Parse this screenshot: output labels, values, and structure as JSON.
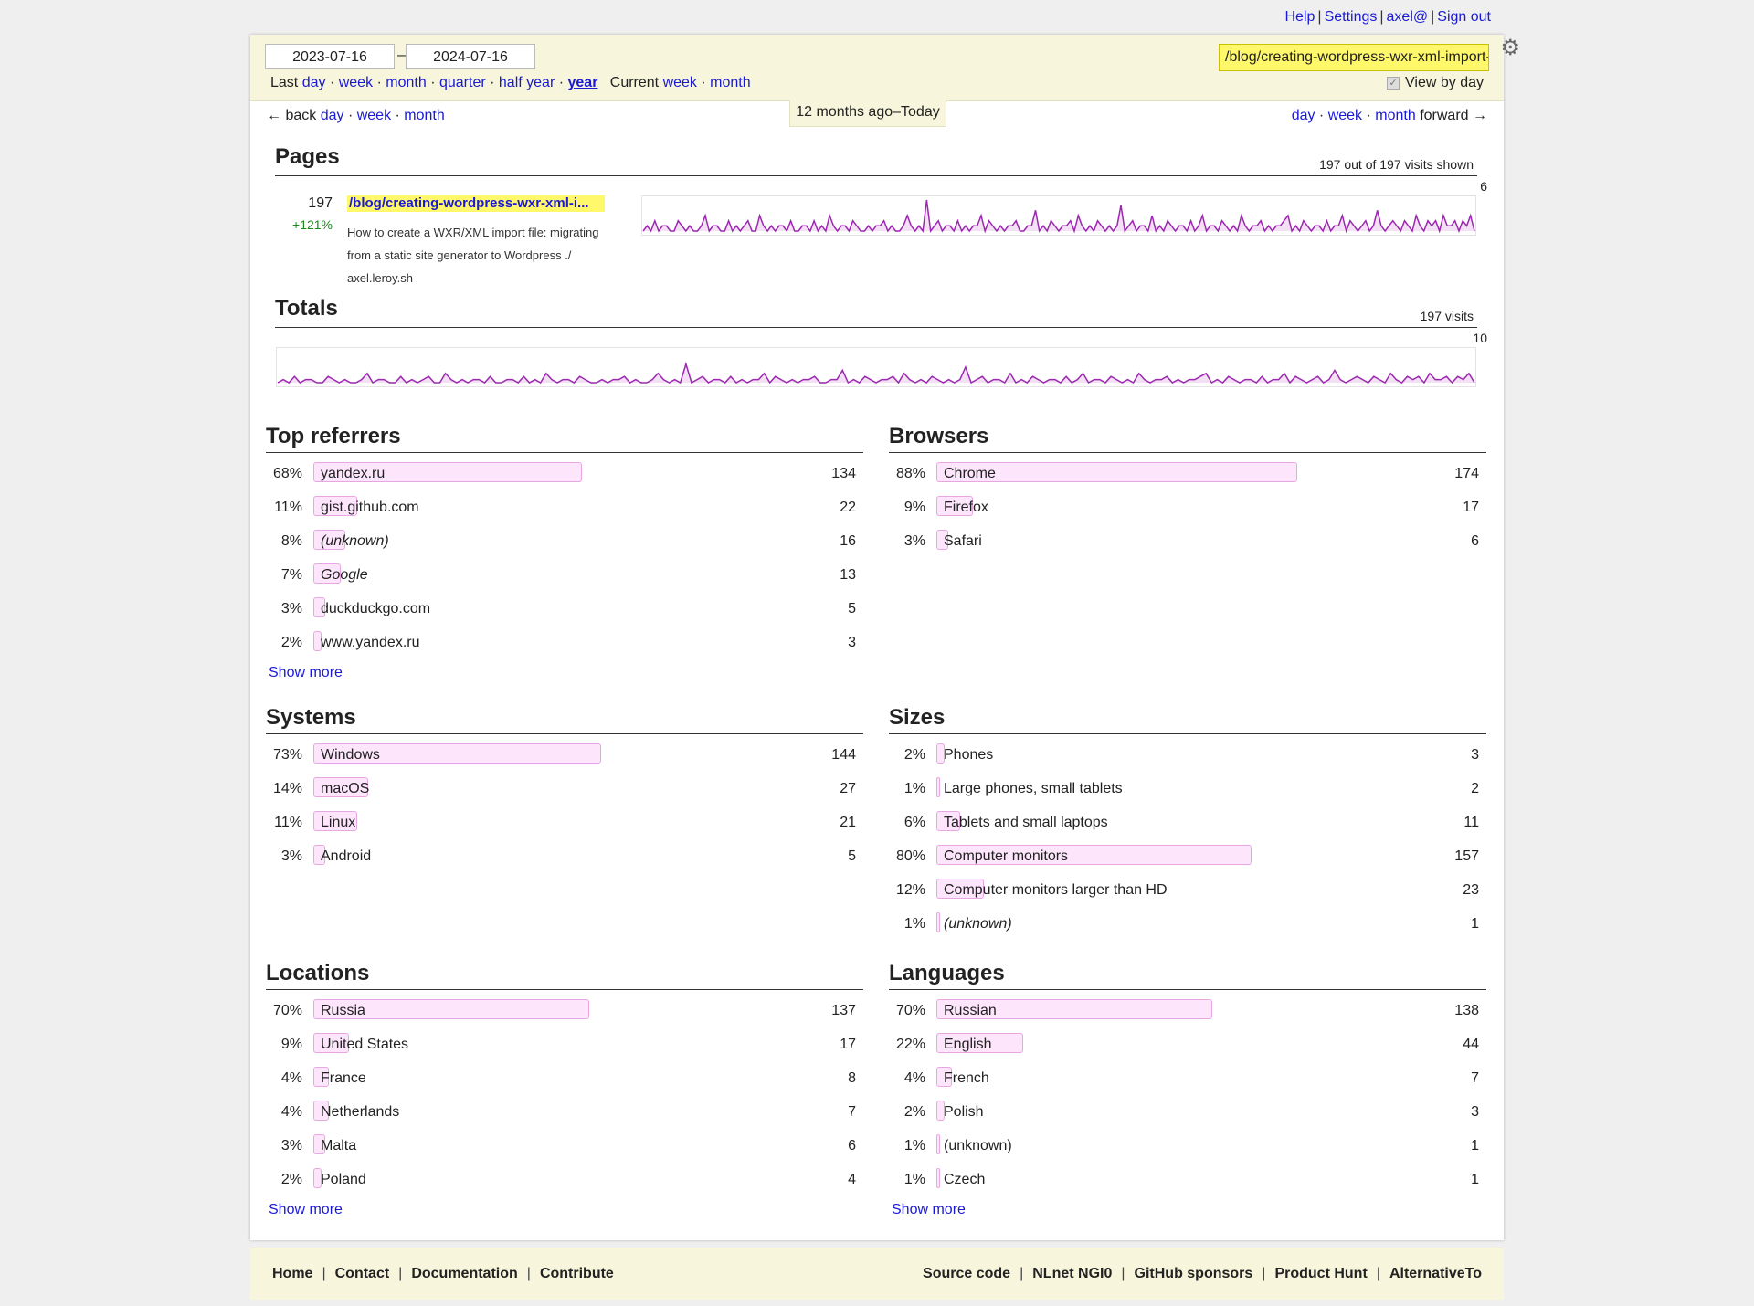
{
  "top_nav": {
    "help": "Help",
    "settings": "Settings",
    "user": "axel@",
    "signout": "Sign out",
    "sep": "|"
  },
  "filter": {
    "start_date": "2023-07-16",
    "end_date": "2024-07-16",
    "dash": "–",
    "last_label": "Last",
    "last_options": [
      "day",
      "week",
      "month",
      "quarter",
      "half year",
      "year"
    ],
    "selected": "year",
    "current_label": "Current",
    "current_options": [
      "week",
      "month"
    ],
    "path_filter": "/blog/creating-wordpress-wxr-xml-import-file",
    "view_by_day": "View by day"
  },
  "period_nav": {
    "back": "← back",
    "forward": "forward →",
    "options": [
      "day",
      "week",
      "month"
    ],
    "period": "12 months ago–Today"
  },
  "pages": {
    "title": "Pages",
    "shown": "197 out of 197 visits shown",
    "max": "6",
    "row": {
      "count": "197",
      "change": "+121%",
      "path": "/blog/creating-wordpress-wxr-xml-i...",
      "desc": "How to create a WXR/XML import file: migrating from a static site generator to Wordpress ./ axel.leroy.sh",
      "daily": [
        0,
        1,
        0,
        2,
        0,
        1,
        1,
        0,
        0,
        2,
        1,
        0,
        1,
        0,
        0,
        1,
        3,
        0,
        1,
        1,
        0,
        0,
        2,
        0,
        1,
        0,
        1,
        2,
        0,
        0,
        3,
        1,
        0,
        1,
        0,
        1,
        1,
        0,
        2,
        0,
        0,
        1,
        1,
        0,
        2,
        0,
        1,
        0,
        3,
        1,
        0,
        1,
        1,
        0,
        2,
        1,
        0,
        0,
        1,
        0,
        1,
        1,
        2,
        0,
        1,
        0,
        0,
        1,
        3,
        1,
        0,
        1,
        0,
        6,
        0,
        1,
        2,
        0,
        1,
        1,
        0,
        2,
        0,
        1,
        0,
        1,
        1,
        3,
        0,
        2,
        1,
        0,
        1,
        0,
        1,
        1,
        2,
        0,
        0,
        1,
        1,
        4,
        0,
        1,
        0,
        2,
        1,
        0,
        1,
        1,
        2,
        0,
        3,
        1,
        0,
        1,
        0,
        2,
        1,
        0,
        1,
        0,
        1,
        5,
        0,
        1,
        2,
        0,
        1,
        1,
        0,
        3,
        0,
        1,
        0,
        2,
        1,
        0,
        1,
        1,
        0,
        2,
        0,
        1,
        3,
        0,
        1,
        1,
        0,
        2,
        1,
        0,
        1,
        0,
        3,
        1,
        0,
        1,
        1,
        2,
        0,
        1,
        0,
        1,
        1,
        2,
        3,
        0,
        1,
        0,
        2,
        1,
        0,
        1,
        1,
        0,
        2,
        0,
        1,
        1,
        3,
        0,
        2,
        1,
        0,
        1,
        2,
        0,
        1,
        4,
        1,
        0,
        1,
        2,
        1,
        0,
        2,
        1,
        0,
        3,
        1,
        0,
        2,
        1,
        2,
        0,
        3,
        1,
        1,
        2,
        0,
        2,
        1,
        3,
        0
      ]
    }
  },
  "totals": {
    "title": "Totals",
    "visits": "197 visits",
    "max": "10",
    "daily": [
      0,
      1,
      0,
      2,
      0,
      1,
      1,
      0,
      0,
      2,
      1,
      0,
      1,
      0,
      0,
      1,
      3,
      0,
      1,
      1,
      0,
      0,
      2,
      0,
      1,
      0,
      1,
      2,
      0,
      0,
      3,
      1,
      0,
      1,
      0,
      1,
      1,
      0,
      2,
      0,
      0,
      1,
      1,
      0,
      2,
      0,
      1,
      0,
      3,
      1,
      0,
      1,
      1,
      0,
      2,
      1,
      0,
      0,
      1,
      0,
      1,
      1,
      2,
      0,
      1,
      0,
      0,
      1,
      3,
      1,
      0,
      1,
      0,
      6,
      0,
      1,
      2,
      0,
      1,
      1,
      0,
      2,
      0,
      1,
      0,
      1,
      1,
      3,
      0,
      2,
      1,
      0,
      1,
      0,
      1,
      1,
      2,
      0,
      0,
      1,
      1,
      4,
      0,
      1,
      0,
      2,
      1,
      0,
      1,
      1,
      2,
      0,
      3,
      1,
      0,
      1,
      0,
      2,
      1,
      0,
      1,
      0,
      1,
      5,
      0,
      1,
      2,
      0,
      1,
      1,
      0,
      3,
      0,
      1,
      0,
      2,
      1,
      0,
      1,
      1,
      0,
      2,
      0,
      1,
      3,
      0,
      1,
      1,
      0,
      2,
      1,
      0,
      1,
      0,
      3,
      1,
      0,
      1,
      1,
      2,
      0,
      1,
      0,
      1,
      1,
      2,
      3,
      0,
      1,
      0,
      2,
      1,
      0,
      1,
      1,
      0,
      2,
      0,
      1,
      1,
      3,
      0,
      2,
      1,
      0,
      1,
      2,
      0,
      1,
      4,
      1,
      0,
      1,
      2,
      1,
      0,
      2,
      1,
      0,
      3,
      1,
      0,
      2,
      1,
      2,
      0,
      3,
      1,
      1,
      2,
      0,
      2,
      1,
      3,
      0
    ]
  },
  "referrers": {
    "title": "Top referrers",
    "show_more": "Show more",
    "rows": [
      {
        "pct": "68%",
        "p": 68,
        "label": "yandex.ru",
        "count": "134"
      },
      {
        "pct": "11%",
        "p": 11,
        "label": "gist.github.com",
        "count": "22"
      },
      {
        "pct": "8%",
        "p": 8,
        "label": "(unknown)",
        "count": "16",
        "italic": true
      },
      {
        "pct": "7%",
        "p": 7,
        "label": "Google",
        "count": "13",
        "italic": true
      },
      {
        "pct": "3%",
        "p": 3,
        "label": "duckduckgo.com",
        "count": "5"
      },
      {
        "pct": "2%",
        "p": 2,
        "label": "www.yandex.ru",
        "count": "3"
      }
    ]
  },
  "browsers": {
    "title": "Browsers",
    "rows": [
      {
        "pct": "88%",
        "p": 88,
        "label": "Chrome",
        "count": "174"
      },
      {
        "pct": "9%",
        "p": 9,
        "label": "Firefox",
        "count": "17"
      },
      {
        "pct": "3%",
        "p": 3,
        "label": "Safari",
        "count": "6"
      }
    ]
  },
  "systems": {
    "title": "Systems",
    "rows": [
      {
        "pct": "73%",
        "p": 73,
        "label": "Windows",
        "count": "144"
      },
      {
        "pct": "14%",
        "p": 14,
        "label": "macOS",
        "count": "27"
      },
      {
        "pct": "11%",
        "p": 11,
        "label": "Linux",
        "count": "21"
      },
      {
        "pct": "3%",
        "p": 3,
        "label": "Android",
        "count": "5"
      }
    ]
  },
  "sizes": {
    "title": "Sizes",
    "rows": [
      {
        "pct": "2%",
        "p": 2,
        "label": "Phones",
        "count": "3"
      },
      {
        "pct": "1%",
        "p": 1,
        "label": "Large phones, small tablets",
        "count": "2"
      },
      {
        "pct": "6%",
        "p": 6,
        "label": "Tablets and small laptops",
        "count": "11"
      },
      {
        "pct": "80%",
        "p": 80,
        "label": "Computer monitors",
        "count": "157"
      },
      {
        "pct": "12%",
        "p": 12,
        "label": "Computer monitors larger than HD",
        "count": "23"
      },
      {
        "pct": "1%",
        "p": 1,
        "label": "(unknown)",
        "count": "1",
        "italic": true
      }
    ]
  },
  "locations": {
    "title": "Locations",
    "show_more": "Show more",
    "rows": [
      {
        "pct": "70%",
        "p": 70,
        "label": "Russia",
        "count": "137"
      },
      {
        "pct": "9%",
        "p": 9,
        "label": "United States",
        "count": "17"
      },
      {
        "pct": "4%",
        "p": 4,
        "label": "France",
        "count": "8"
      },
      {
        "pct": "4%",
        "p": 4,
        "label": "Netherlands",
        "count": "7"
      },
      {
        "pct": "3%",
        "p": 3,
        "label": "Malta",
        "count": "6"
      },
      {
        "pct": "2%",
        "p": 2,
        "label": "Poland",
        "count": "4"
      }
    ]
  },
  "languages": {
    "title": "Languages",
    "show_more": "Show more",
    "rows": [
      {
        "pct": "70%",
        "p": 70,
        "label": "Russian",
        "count": "138"
      },
      {
        "pct": "22%",
        "p": 22,
        "label": "English",
        "count": "44"
      },
      {
        "pct": "4%",
        "p": 4,
        "label": "French",
        "count": "7"
      },
      {
        "pct": "2%",
        "p": 2,
        "label": "Polish",
        "count": "3"
      },
      {
        "pct": "1%",
        "p": 1,
        "label": "(unknown)",
        "count": "1"
      },
      {
        "pct": "1%",
        "p": 1,
        "label": "Czech",
        "count": "1"
      }
    ]
  },
  "footer": {
    "left": [
      "Home",
      "Contact",
      "Documentation",
      "Contribute"
    ],
    "right": [
      "Source code",
      "NLnet NGI0",
      "GitHub sponsors",
      "Product Hunt",
      "AlternativeTo"
    ]
  },
  "colors": {
    "accent": "#9c27b0",
    "bar_fill": "#fde6fc",
    "highlight": "#fff86a",
    "link": "#1a1ad6"
  }
}
